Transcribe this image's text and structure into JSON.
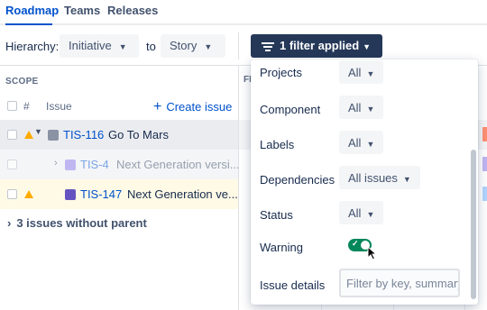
{
  "tabs": [
    "Roadmap",
    "Teams",
    "Releases"
  ],
  "filters": {
    "hierarchy_label": "Hierarchy:",
    "from_value": "Initiative",
    "to_label": "to",
    "to_value": "Story",
    "filter_button_label": "1 filter applied"
  },
  "table": {
    "scope_label": "SCOPE",
    "col_hash": "#",
    "col_issue": "Issue",
    "create_label": "Create issue",
    "partial_col": "FI",
    "rows": [
      {
        "key": "TIS-116",
        "title": "Go To Mars"
      },
      {
        "key": "TIS-4",
        "title": "Next Generation versi..."
      },
      {
        "key": "TIS-147",
        "title": "Next Generation ve..."
      }
    ],
    "without_parent": "3 issues without parent"
  },
  "panel": {
    "rows": [
      {
        "label": "Projects",
        "value": "All"
      },
      {
        "label": "Component",
        "value": "All"
      },
      {
        "label": "Labels",
        "value": "All"
      },
      {
        "label": "Dependencies",
        "value": "All issues"
      },
      {
        "label": "Status",
        "value": "All"
      }
    ],
    "warning_label": "Warning",
    "warning_enabled": true,
    "issue_details_label": "Issue details",
    "issue_details_placeholder": "Filter by key, summary"
  },
  "colors": {
    "accent": "#0052cc",
    "filter_button": "#253858",
    "toggle_on": "#00875a",
    "warning": "#ffab00"
  }
}
